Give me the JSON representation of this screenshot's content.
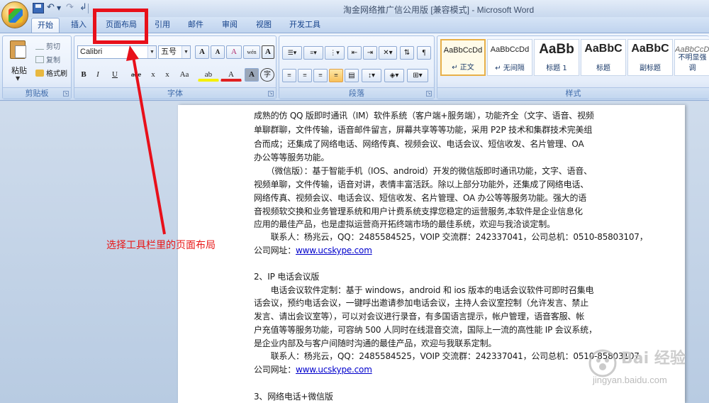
{
  "window": {
    "title": "淘金网络推广信公用版 [兼容模式] - Microsoft Word"
  },
  "tabs": [
    {
      "label": "开始",
      "active": true
    },
    {
      "label": "插入",
      "active": false
    },
    {
      "label": "页面布局",
      "active": false
    },
    {
      "label": "引用",
      "active": false
    },
    {
      "label": "邮件",
      "active": false
    },
    {
      "label": "审阅",
      "active": false
    },
    {
      "label": "视图",
      "active": false
    },
    {
      "label": "开发工具",
      "active": false
    }
  ],
  "clipboard": {
    "paste_label": "粘贴",
    "cut_label": "剪切",
    "copy_label": "复制",
    "format_painter_label": "格式刷",
    "group_label": "剪贴板"
  },
  "font": {
    "font_name": "Calibri",
    "font_size": "五号",
    "grow_label": "A",
    "shrink_label": "A",
    "clear_label": "A",
    "phonetic_label": "wén",
    "border_label": "A",
    "bold_label": "B",
    "italic_label": "I",
    "underline_label": "U",
    "strike_label": "abe",
    "subscript_label": "x",
    "superscript_label": "x",
    "case_label": "Aa",
    "highlight_label": "ab",
    "color_label": "A",
    "shade_label": "A",
    "enclose_label": "字",
    "group_label": "字体"
  },
  "paragraph": {
    "group_label": "段落"
  },
  "styles": {
    "group_label": "样式",
    "items": [
      {
        "sample": "AaBbCcDd",
        "name": "↵ 正文",
        "selected": true
      },
      {
        "sample": "AaBbCcDd",
        "name": "↵ 无间隔",
        "selected": false
      },
      {
        "sample": "AaBb",
        "name": "标题 1",
        "selected": false
      },
      {
        "sample": "AaBbC",
        "name": "标题",
        "selected": false
      },
      {
        "sample": "AaBbC",
        "name": "副标题",
        "selected": false
      },
      {
        "sample": "AaBbCcDc",
        "name": "不明显强调",
        "selected": false
      }
    ]
  },
  "document": {
    "lines": [
      "成熟的仿 QQ 版即时通讯（IM）软件系统（客户端+服务端），功能齐全（文字、语音、视频",
      "单聊群聊，文件传输，语音邮件留言，屏幕共享等等功能，采用 P2P 技术和集群技术完美组",
      "合而成；还集成了网络电话、网络传真、视频会议、电话会议、短信收发、名片管理、OA",
      "办公等等服务功能。",
      "　　（微信版）：基于智能手机（IOS、android）开发的微信版即时通讯功能，文字、语音、",
      "视频单聊，文件传输，语音对讲，表情丰富活跃。除以上部分功能外，还集成了网络电话、",
      "网络传真、视频会议、电话会议、短信收发、名片管理、OA 办公等等服务功能。强大的语",
      "音视频软交换和业务管理系统和用户计费系统支撑您稳定的运营服务,本软件是企业信息化",
      "应用的最佳产品，也是虚拟运营商开拓终端市场的最佳系统，欢迎与我洽谈定制。",
      "　　联系人：杨兆云，QQ：2485584525，VOIP 交流群：242337041，公司总机：0510-85803107，",
      "公司网址：",
      "2、IP 电话会议版",
      "　　电话会议软件定制：基于 windows，android 和 ios 版本的电话会议软件可即时召集电",
      "话会议，预约电话会议，一键呼出邀请参加电话会议，主持人会议室控制（允许发言、禁止",
      "发言、请出会议室等），可以对会议进行录音，有多国语言提示，帐户管理，语音客服、帐",
      "户充值等等服务功能，可容纳 500 人同时在线混音交流，国际上一流的高性能 IP 会议系统，",
      "是企业内部及与客户间随时沟通的最佳产品，欢迎与我联系定制。",
      "　　联系人：杨兆云，QQ：2485584525，VOIP 交流群：242337041，公司总机：0510-85803107",
      "公司网址：",
      "3、网络电话+微信版"
    ],
    "url_1": "www.ucskype.com",
    "url_2": "www.ucskype.com"
  },
  "annotation": {
    "text": "选择工具栏里的页面布局",
    "color": "#e8101a"
  },
  "watermark": {
    "main": "Bai 经验",
    "sub": "jingyan.baidu.com"
  }
}
